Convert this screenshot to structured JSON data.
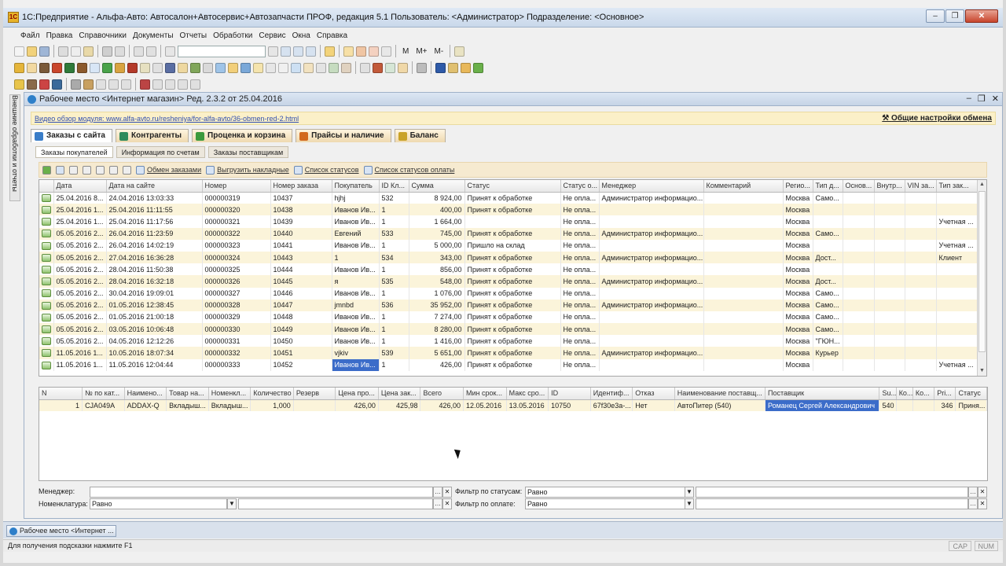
{
  "window": {
    "title": "1С:Предприятие - Альфа-Авто: Автосалон+Автосервис+Автозапчасти ПРОФ, редакция 5.1    Пользователь: <Администратор>    Подразделение: <Основное>",
    "app_icon": "1С"
  },
  "menu": [
    "Файл",
    "Правка",
    "Справочники",
    "Документы",
    "Отчеты",
    "Обработки",
    "Сервис",
    "Окна",
    "Справка"
  ],
  "toolbar": {
    "m_labels": [
      "M",
      "M+",
      "M-"
    ]
  },
  "side_panel": {
    "label": "Внешние обработки и отчеты"
  },
  "workspace": {
    "title": "Рабочее место <Интернет магазин> Ред. 2.3.2 от 25.04.2016",
    "video_link": "Видео обзор модуля: www.alfa-avto.ru/resheniya/for-alfa-avto/36-obmen-red-2.html",
    "settings_link": "Общие настройки обмена",
    "tabs": [
      {
        "label": "Заказы с сайта",
        "color": "#3a7dc8"
      },
      {
        "label": "Контрагенты",
        "color": "#2e8a5b"
      },
      {
        "label": "Проценка и корзина",
        "color": "#3c9a3c"
      },
      {
        "label": "Прайсы и наличие",
        "color": "#d2691e"
      },
      {
        "label": "Баланс",
        "color": "#c9a227"
      }
    ],
    "subtabs": [
      "Заказы покупателей",
      "Информация по счетам",
      "Заказы поставщикам"
    ],
    "grid_toolbar": [
      "Обмен заказами",
      "Выгрузить накладные",
      "Список статусов",
      "Список статусов оплаты"
    ]
  },
  "orders": {
    "columns": [
      "",
      "Дата",
      "Дата на сайте",
      "Номер",
      "Номер заказа",
      "Покупатель",
      "ID Кл...",
      "Сумма",
      "Статус",
      "Статус о...",
      "Менеджер",
      "Комментарий",
      "Регио...",
      "Тип д...",
      "Основ...",
      "Внутр...",
      "VIN за...",
      "Тип зак..."
    ],
    "rows": [
      [
        "25.04.2016 8...",
        "24.04.2016 13:03:33",
        "000000319",
        "10437",
        "hjhj",
        "532",
        "8 924,00",
        "Принят к обработке",
        "Не опла...",
        "Администратор информацио...",
        "",
        "Москва",
        "Само...",
        "",
        "",
        "",
        ""
      ],
      [
        "25.04.2016 1...",
        "25.04.2016 11:11:55",
        "000000320",
        "10438",
        "Иванов Ив...",
        "1",
        "400,00",
        "Принят к обработке",
        "Не опла...",
        "",
        "",
        "Москва",
        "",
        "",
        "",
        "",
        ""
      ],
      [
        "25.04.2016 1...",
        "25.04.2016 11:17:56",
        "000000321",
        "10439",
        "Иванов Ив...",
        "1",
        "1 664,00",
        "",
        "Не опла...",
        "",
        "",
        "Москва",
        "",
        "",
        "",
        "",
        "Учетная ..."
      ],
      [
        "05.05.2016 2...",
        "26.04.2016 11:23:59",
        "000000322",
        "10440",
        "Евгений",
        "533",
        "745,00",
        "Принят к обработке",
        "Не опла...",
        "Администратор информацио...",
        "",
        "Москва",
        "Само...",
        "",
        "",
        "",
        ""
      ],
      [
        "05.05.2016 2...",
        "26.04.2016 14:02:19",
        "000000323",
        "10441",
        "Иванов Ив...",
        "1",
        "5 000,00",
        "Пришло на склад",
        "Не опла...",
        "",
        "",
        "Москва",
        "",
        "",
        "",
        "",
        "Учетная ..."
      ],
      [
        "05.05.2016 2...",
        "27.04.2016 16:36:28",
        "000000324",
        "10443",
        "1",
        "534",
        "343,00",
        "Принят к обработке",
        "Не опла...",
        "Администратор информацио...",
        "",
        "Москва",
        "Дост...",
        "",
        "",
        "",
        "Клиент"
      ],
      [
        "05.05.2016 2...",
        "28.04.2016 11:50:38",
        "000000325",
        "10444",
        "Иванов Ив...",
        "1",
        "856,00",
        "Принят к обработке",
        "Не опла...",
        "",
        "",
        "Москва",
        "",
        "",
        "",
        "",
        ""
      ],
      [
        "05.05.2016 2...",
        "28.04.2016 16:32:18",
        "000000326",
        "10445",
        "я",
        "535",
        "548,00",
        "Принят к обработке",
        "Не опла...",
        "Администратор информацио...",
        "",
        "Москва",
        "Дост...",
        "",
        "",
        "",
        ""
      ],
      [
        "05.05.2016 2...",
        "30.04.2016 19:09:01",
        "000000327",
        "10446",
        "Иванов Ив...",
        "1",
        "1 076,00",
        "Принят к обработке",
        "Не опла...",
        "",
        "",
        "Москва",
        "Само...",
        "",
        "",
        "",
        ""
      ],
      [
        "05.05.2016 2...",
        "01.05.2016 12:38:45",
        "000000328",
        "10447",
        "jmnbd",
        "536",
        "35 952,00",
        "Принят к обработке",
        "Не опла...",
        "Администратор информацио...",
        "",
        "Москва",
        "Само...",
        "",
        "",
        "",
        ""
      ],
      [
        "05.05.2016 2...",
        "01.05.2016 21:00:18",
        "000000329",
        "10448",
        "Иванов Ив...",
        "1",
        "7 274,00",
        "Принят к обработке",
        "Не опла...",
        "",
        "",
        "Москва",
        "Само...",
        "",
        "",
        "",
        ""
      ],
      [
        "05.05.2016 2...",
        "03.05.2016 10:06:48",
        "000000330",
        "10449",
        "Иванов Ив...",
        "1",
        "8 280,00",
        "Принят к обработке",
        "Не опла...",
        "",
        "",
        "Москва",
        "Само...",
        "",
        "",
        "",
        ""
      ],
      [
        "05.05.2016 2...",
        "04.05.2016 12:12:26",
        "000000331",
        "10450",
        "Иванов Ив...",
        "1",
        "1 416,00",
        "Принят к обработке",
        "Не опла...",
        "",
        "",
        "Москва",
        "\"ГЮН...",
        "",
        "",
        "",
        ""
      ],
      [
        "11.05.2016 1...",
        "10.05.2016 18:07:34",
        "000000332",
        "10451",
        "vjkiv",
        "539",
        "5 651,00",
        "Принят к обработке",
        "Не опла...",
        "Администратор информацио...",
        "",
        "Москва",
        "Курьер",
        "",
        "",
        "",
        ""
      ],
      [
        "11.05.2016 1...",
        "11.05.2016 12:04:44",
        "000000333",
        "10452",
        "Иванов Ив...",
        "1",
        "426,00",
        "Принят к обработке",
        "Не опла...",
        "",
        "",
        "Москва",
        "",
        "",
        "",
        "",
        "Учетная ..."
      ]
    ]
  },
  "details": {
    "columns": [
      "N",
      "№ по кат...",
      "Наимено...",
      "Товар на...",
      "Номенкл...",
      "Количество",
      "Резерв",
      "Цена про...",
      "Цена зак...",
      "Всего",
      "Мин срок...",
      "Макс сро...",
      "ID",
      "Идентиф...",
      "Отказ",
      "Наименование поставщ...",
      "Поставщик",
      "Su...",
      "Ко...",
      "Ко...",
      "Pri...",
      "Статус"
    ],
    "rows": [
      [
        "1",
        "CJA049A",
        "ADDAX-Q",
        "Вкладыш...",
        "Вкладыш...",
        "1,000",
        "",
        "426,00",
        "425,98",
        "426,00",
        "12.05.2016",
        "13.05.2016",
        "10750",
        "67f30e3a-...",
        "Нет",
        "АвтоПитер (540)",
        "Романец Сергей Александрович",
        "540",
        "",
        "",
        "346",
        "Приня..."
      ]
    ]
  },
  "filters": {
    "manager_label": "Менеджер:",
    "nomenclature_label": "Номенклатура:",
    "nomenclature_value": "Равно",
    "status_label": "Фильтр по статусам:",
    "status_value": "Равно",
    "payment_label": "Фильтр по оплате:",
    "payment_value": "Равно"
  },
  "taskbar": {
    "item": "Рабочее место <Интернет ..."
  },
  "statusbar": {
    "hint": "Для получения подсказки нажмите F1",
    "cap": "CAP",
    "num": "NUM"
  }
}
